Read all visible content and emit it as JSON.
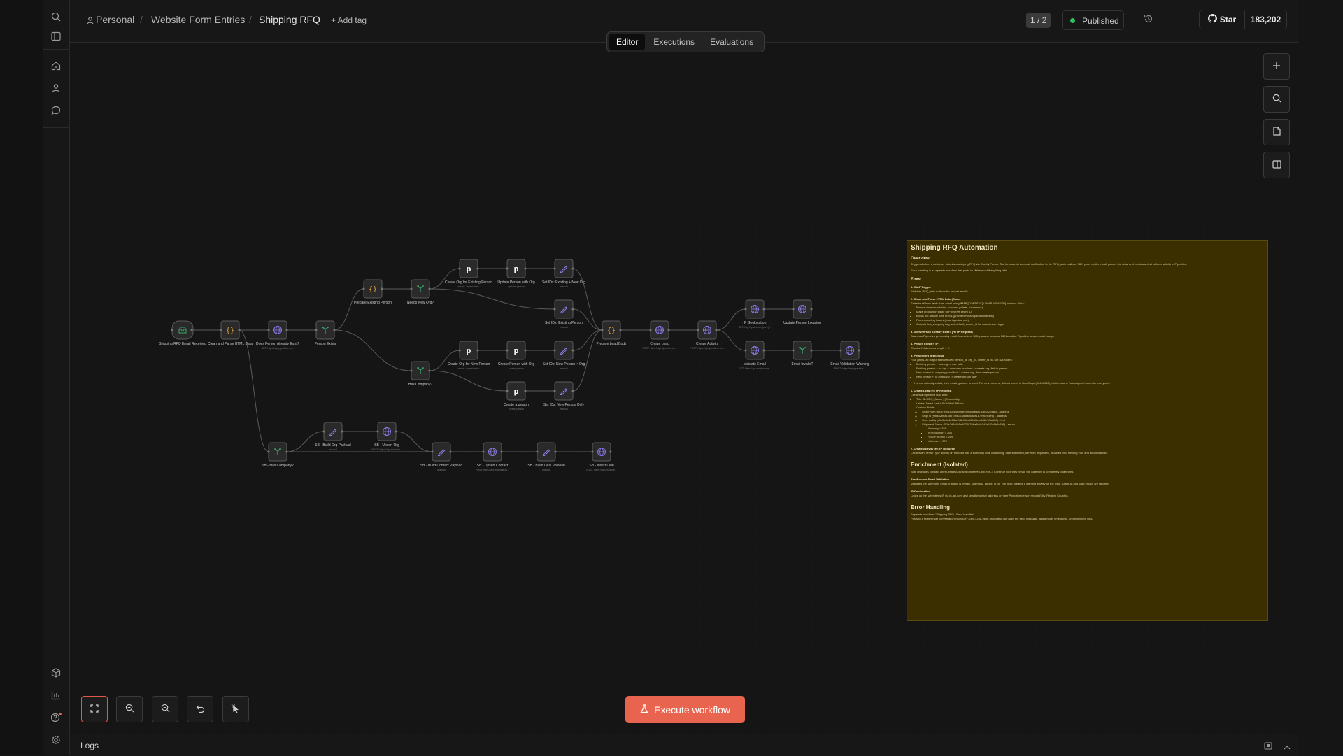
{
  "breadcrumb": {
    "project": "Personal",
    "folder": "Website Form Entries",
    "workflow": "Shipping RFQ",
    "add_tag": "+ Add tag"
  },
  "header": {
    "version": "1 / 2",
    "status": "Published",
    "github_star": "Star",
    "github_count": "183,202"
  },
  "tabs": [
    {
      "label": "Editor",
      "active": true
    },
    {
      "label": "Executions",
      "active": false
    },
    {
      "label": "Evaluations",
      "active": false
    }
  ],
  "sidebar": {
    "icons": [
      "search-icon",
      "panel-icon",
      "home-icon",
      "user-icon",
      "chat-icon",
      "templates-icon",
      "insights-icon",
      "help-icon",
      "settings-icon"
    ]
  },
  "canvas_tools": [
    "add-node-icon",
    "search-icon",
    "file-icon",
    "panel-toggle-icon"
  ],
  "bottom_tools": [
    "fit-view-icon",
    "zoom-in-icon",
    "zoom-out-icon",
    "undo-icon",
    "clean-up-icon"
  ],
  "execute_button": "Execute workflow",
  "logs_label": "Logs",
  "nodes": [
    {
      "id": "n1",
      "label": "Shipping RFQ Email Received",
      "sub": "",
      "icon": "email",
      "color": "#3aa66b"
    },
    {
      "id": "n2",
      "label": "Clean and Parse HTML Data",
      "sub": "",
      "icon": "code",
      "color": "#e6a23a"
    },
    {
      "id": "n3",
      "label": "Does Person Already Exist?",
      "sub": "GET: https://api.pipedrive.co...",
      "icon": "globe",
      "color": "#8a7be6"
    },
    {
      "id": "n4",
      "label": "Person Exists",
      "sub": "",
      "icon": "if",
      "color": "#3aa66b"
    },
    {
      "id": "n5",
      "label": "Prepare Existing Person",
      "sub": "",
      "icon": "code",
      "color": "#e6a23a"
    },
    {
      "id": "n6",
      "label": "Needs New Org?",
      "sub": "",
      "icon": "if",
      "color": "#3aa66b"
    },
    {
      "id": "n7",
      "label": "Create Org for Existing Person",
      "sub": "create: organization",
      "icon": "pipedrive",
      "color": "#ffffff"
    },
    {
      "id": "n8",
      "label": "Update Person with Org",
      "sub": "update: person",
      "icon": "pipedrive",
      "color": "#ffffff"
    },
    {
      "id": "n9",
      "label": "Set IDs: Existing + New Org",
      "sub": "manual",
      "icon": "pen",
      "color": "#8a7be6"
    },
    {
      "id": "n10",
      "label": "Set IDs: Existing Person",
      "sub": "manual",
      "icon": "pen",
      "color": "#8a7be6"
    },
    {
      "id": "n11",
      "label": "Has Company?",
      "sub": "",
      "icon": "if",
      "color": "#3aa66b"
    },
    {
      "id": "n12",
      "label": "Create Org for New Person",
      "sub": "create: organization",
      "icon": "pipedrive",
      "color": "#ffffff"
    },
    {
      "id": "n13",
      "label": "Create Person with Org",
      "sub": "create: person",
      "icon": "pipedrive",
      "color": "#ffffff"
    },
    {
      "id": "n14",
      "label": "Set IDs: New Person + Org",
      "sub": "manual",
      "icon": "pen",
      "color": "#8a7be6"
    },
    {
      "id": "n15",
      "label": "Create a person",
      "sub": "create: person",
      "icon": "pipedrive",
      "color": "#ffffff"
    },
    {
      "id": "n16",
      "label": "Set IDs: New Person Only",
      "sub": "manual",
      "icon": "pen",
      "color": "#8a7be6"
    },
    {
      "id": "n17",
      "label": "Prepare Lead Body",
      "sub": "",
      "icon": "code",
      "color": "#e6a23a"
    },
    {
      "id": "n18",
      "label": "Create Lead",
      "sub": "POST: https://api.pipedrive.co...",
      "icon": "globe",
      "color": "#8a7be6"
    },
    {
      "id": "n19",
      "label": "Create Activity",
      "sub": "POST: https://api.pipedrive.co...",
      "icon": "globe",
      "color": "#8a7be6"
    },
    {
      "id": "n20",
      "label": "IP Geolocation",
      "sub": "GET: http://ip-api.com/json/{i...",
      "icon": "globe",
      "color": "#8a7be6"
    },
    {
      "id": "n21",
      "label": "Update Person Location",
      "sub": "",
      "icon": "globe",
      "color": "#8a7be6"
    },
    {
      "id": "n22",
      "label": "Validate Email",
      "sub": "GET: https://api.zerobounce...",
      "icon": "globe",
      "color": "#8a7be6"
    },
    {
      "id": "n23",
      "label": "Email Invalid?",
      "sub": "",
      "icon": "if",
      "color": "#3aa66b"
    },
    {
      "id": "n24",
      "label": "Email Validation Warning",
      "sub": "POST: https://api.pipedrive...",
      "icon": "globe",
      "color": "#8a7be6"
    },
    {
      "id": "n25",
      "label": "SB - Has Company?",
      "sub": "",
      "icon": "if",
      "color": "#3aa66b"
    },
    {
      "id": "n26",
      "label": "SB - Build Org Payload",
      "sub": "manual",
      "icon": "pen",
      "color": "#8a7be6"
    },
    {
      "id": "n27",
      "label": "SB - Upsert Org",
      "sub": "POST: https://api.example...",
      "icon": "globe",
      "color": "#8a7be6"
    },
    {
      "id": "n28",
      "label": "SB - Build Contact Payload",
      "sub": "manual",
      "icon": "pen",
      "color": "#8a7be6"
    },
    {
      "id": "n29",
      "label": "SB - Upsert Contact",
      "sub": "POST: https://api.example.co...",
      "icon": "globe",
      "color": "#8a7be6"
    },
    {
      "id": "n30",
      "label": "SB - Build Deal Payload",
      "sub": "manual",
      "icon": "pen",
      "color": "#8a7be6"
    },
    {
      "id": "n31",
      "label": "SB - Insert Deal",
      "sub": "POST: https://api.example...",
      "icon": "globe",
      "color": "#8a7be6"
    }
  ],
  "sticky_note": {
    "title": "Shipping RFQ Automation",
    "overview_h": "Overview",
    "overview_p1": "Triggered when a customer submits a shipping RFQ via Gravity Forms. The form sends an email notification to the RFQ_auto mailbox. N8N picks up the email, parses the data, and creates a deal with an activity in Pipedrive.",
    "overview_p2": "Error handling is a separate workflow that posts to Mattermost if anything fails.",
    "flow_h": "Flow",
    "s1_h": "1. IMAP Trigger",
    "s1_p": "Watches RFQ_auto mailbox for unread emails.",
    "s2_h": "2. Clean and Parse HTML Data (Code)",
    "s2_p": "Extracts all form fields from email using IMAP [CONTENT] / IMAP [HEADER] markers. Also:",
    "s2_items": [
      "Parses dimension tables (cartons, pallets, containers)",
      "Maps production stage to Pipedrive enum ID",
      "Builds the activity note HTML (provided/missing/additional info)",
      "Fixes encoding issues (smart quotes, etc.)",
      "Outputs has_company flag and default_owner_id for downstream logic"
    ],
    "s3_h": "3. Does Person Already Exist? (HTTP Request)",
    "s3_p": "Searches Pipedrive persons by email. Uses direct URL params because N8N's native Pipedrive search node hangs.",
    "s4_h": "4. Person Exists? (IF)",
    "s4_p": "Checks if data.items length > 0.",
    "s5_h": "5. Person/Org Branching",
    "s5_p": "Four paths, all output standardized person_id, org_id, owner_id via Set IDs nodes:",
    "s5_items": [
      "Existing person + has org -> use both",
      "Existing person + no org + company provided -> create org, link to person",
      "New person + company provided -> create org, then create person",
      "New person + no company -> create person only"
    ],
    "s5_p2": "If person already exists, their existing owner is used. For new persons, default owner is Sam Boyd (12460913), which means \"unassigned / open for everyone\".",
    "s6_h": "6. Create Lead (HTTP Request)",
    "s6_p": "Creates a Pipedrive lead with:",
    "s6_items": [
      "Title: ID-RFQ | Name | [Commodity]",
      "Labels: New Lead + 8e7b9ba0-5f1ddc",
      "Custom Fields:"
    ],
    "s6_sub": [
      "Ship From (bbdf7b9c1c0ca0f9bae4b9f5d8b3d7a1b4d2c4a6) - address",
      "Ship To (f9b4d2e6a1c8b7d9e2c3a5f4b6d8e1a7b9c2d4e6) - address",
      "Commodity (a1b2c3d4e5f6a7b8c9d0e1f2a3b4c5d6e7f8a9b0) - text",
      "Shipment Status (0f1e2d3c4b5a69788796a5b4c3d2e1f0a9b8c7d6) - enum"
    ],
    "s6_enum": [
      "Planning = 288",
      "In Production = 288",
      "Ready to Ship = 289",
      "Unknown = 373"
    ],
    "s7_h": "7. Create Activity (HTTP Request)",
    "s7_p": "Creates an \"email\" type activity on the lead with a summary note containing: date submitted, services requested, provided info, missing info, and additional info.",
    "enr_h": "Enrichment (Isolated)",
    "enr_p": "Both branches connect after Create Activity (both have On Error -> Continue so if they break, the core flow is completely unaffected.",
    "zb_h": "ZeroBounce Email Validation",
    "zb_p": "Validates the submitted email. If status is invalid, spamtrap, abuse, or do_not_mail, creates a warning activity on the lead. Catch-all and valid emails are ignored.",
    "ip_h": "IP Geolocation",
    "ip_p": "Looks up the submitter's IP via ip-api.com and sets the postal_address on their Pipedrive person record (City, Region, Country).",
    "err_h": "Error Handling",
    "err_p1": "Separate workflow: \"Shipping RFQ - Error Handler\"",
    "err_p2": "Posts to a Mattermost conversation (9600f2e7-049f-425a-9b96-0fdddaff6e78d) with the error message, failed node, timestamp, and execution URL."
  }
}
